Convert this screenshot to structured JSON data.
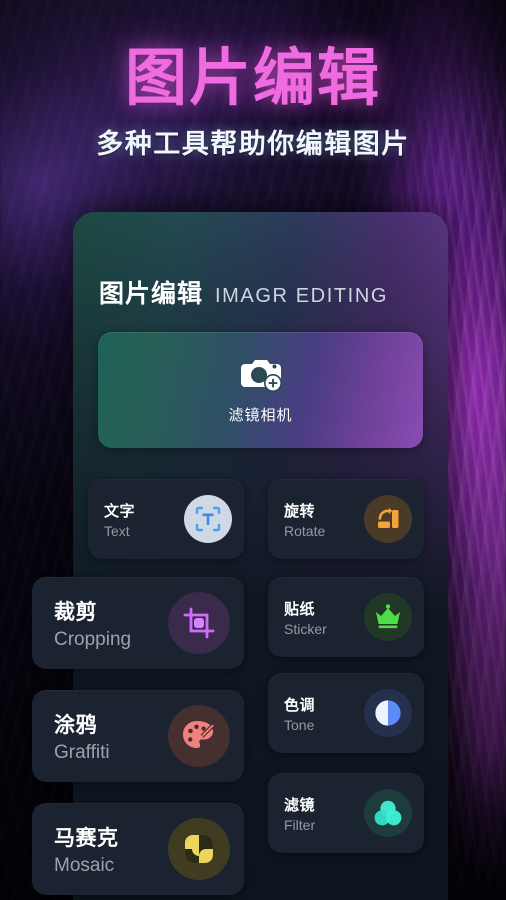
{
  "hero": {
    "title": "图片编辑",
    "subtitle": "多种工具帮助你编辑图片",
    "title_color": "#f06ae0",
    "subtitle_color": "#f2f6ff"
  },
  "card": {
    "header_cn": "图片编辑",
    "header_en": "IMAGR EDITING",
    "gradient_from": "#1d4a42",
    "gradient_to": "#7b44a8",
    "surface_color": "#101722"
  },
  "banner": {
    "label": "滤镜相机",
    "icon": "camera-add-icon",
    "gradient_from": "#1f6257",
    "gradient_to": "#8b4bb4"
  },
  "tools": [
    {
      "cn": "文字",
      "en": "Text",
      "icon": "text-frame-icon",
      "icon_color": "#5aa8f2",
      "icon_bg": "#cfd9e6",
      "column": "right-upper"
    },
    {
      "cn": "旋转",
      "en": "Rotate",
      "icon": "rotate-icon",
      "icon_color": "#f2a33c",
      "icon_bg": "#4a3a28",
      "column": "right"
    },
    {
      "cn": "裁剪",
      "en": "Cropping",
      "icon": "crop-icon",
      "icon_color": "#cf6dfa",
      "icon_bg": "#3a2a4c",
      "column": "left"
    },
    {
      "cn": "贴纸",
      "en": "Sticker",
      "icon": "crown-icon",
      "icon_color": "#4ede4a",
      "icon_bg": "#213826",
      "column": "right"
    },
    {
      "cn": "涂鸦",
      "en": "Graffiti",
      "icon": "palette-brush-icon",
      "icon_color": "#f0827e",
      "icon_bg": "#45302f",
      "column": "left"
    },
    {
      "cn": "色调",
      "en": "Tone",
      "icon": "contrast-icon",
      "icon_color": "#5b8cf7",
      "icon_bg": "#25314c",
      "column": "right"
    },
    {
      "cn": "滤镜",
      "en": "Filter",
      "icon": "three-circles-icon",
      "icon_color": "#3ee8d0",
      "icon_bg": "#1e3c3c",
      "column": "right"
    },
    {
      "cn": "马赛克",
      "en": "Mosaic",
      "icon": "mosaic-icon",
      "icon_color": "#ecd659",
      "icon_bg": "#403c22",
      "column": "left"
    }
  ]
}
